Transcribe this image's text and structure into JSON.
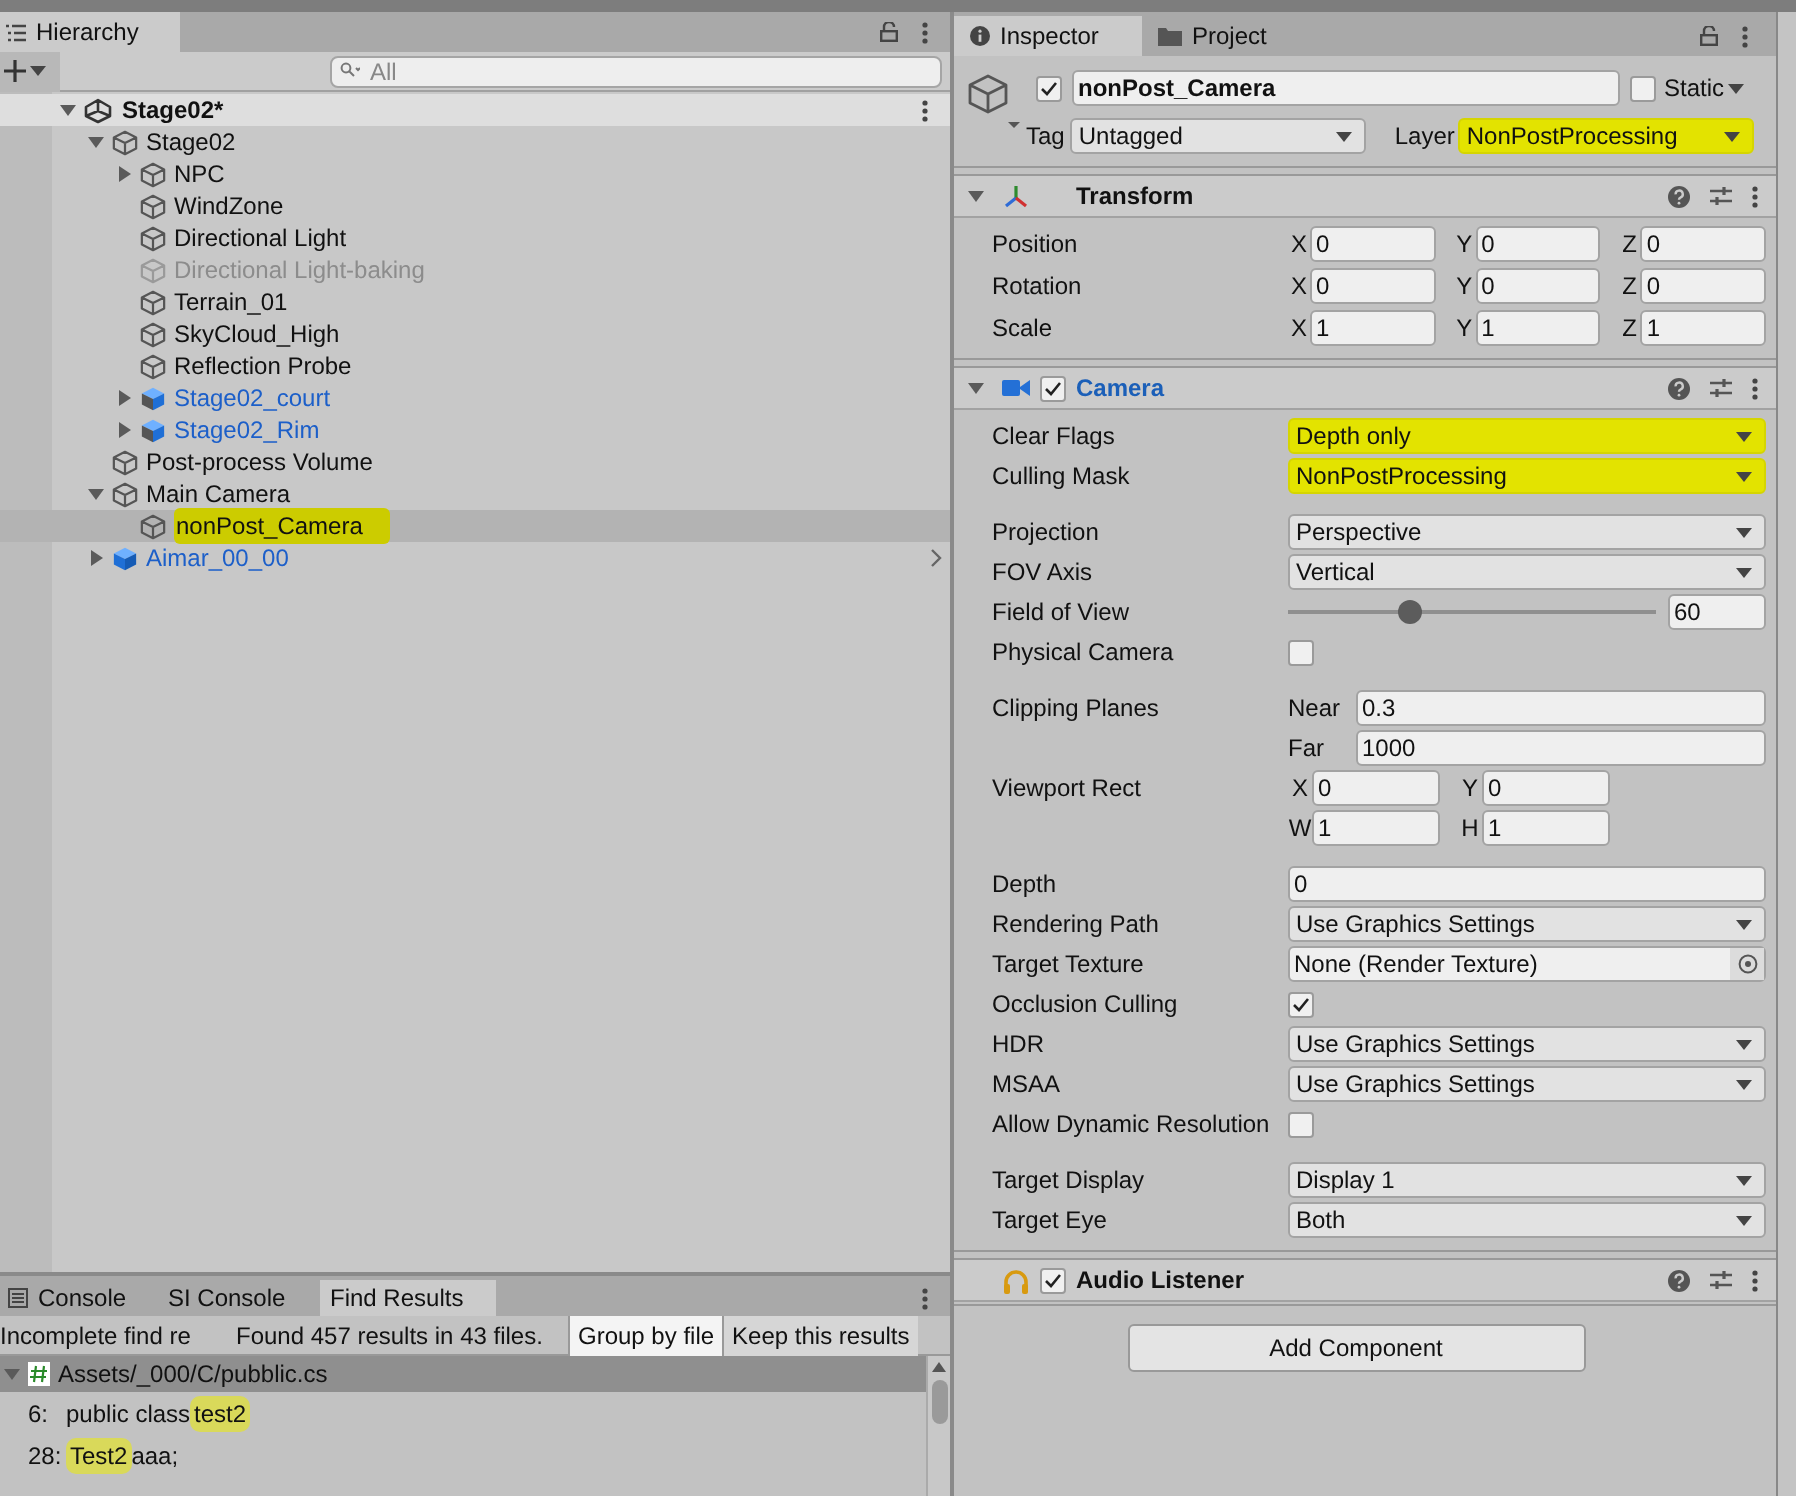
{
  "hierarchy": {
    "title": "Hierarchy",
    "search": {
      "placeholder": "All"
    },
    "scene": {
      "label": "Stage02*",
      "expanded": true,
      "children": [
        {
          "label": "Stage02",
          "kind": "object",
          "expanded": true,
          "disabled": false,
          "selected": false,
          "marked": false,
          "children": [
            {
              "label": "NPC",
              "kind": "object",
              "expanded": false,
              "disabled": false,
              "selected": false,
              "marked": false
            },
            {
              "label": "WindZone",
              "kind": "object",
              "disabled": false,
              "selected": false,
              "marked": false
            },
            {
              "label": "Directional Light",
              "kind": "object",
              "disabled": false,
              "selected": false,
              "marked": false
            },
            {
              "label": "Directional Light-baking",
              "kind": "object",
              "disabled": true,
              "selected": false,
              "marked": false
            },
            {
              "label": "Terrain_01",
              "kind": "object",
              "disabled": false,
              "selected": false,
              "marked": false
            },
            {
              "label": "SkyCloud_High",
              "kind": "object",
              "disabled": false,
              "selected": false,
              "marked": false
            },
            {
              "label": "Reflection Probe",
              "kind": "object",
              "disabled": false,
              "selected": false,
              "marked": false
            },
            {
              "label": "Stage02_court",
              "kind": "model",
              "expanded": false,
              "disabled": false,
              "selected": false,
              "marked": false
            },
            {
              "label": "Stage02_Rim",
              "kind": "model",
              "expanded": false,
              "disabled": false,
              "selected": false,
              "marked": false
            }
          ]
        },
        {
          "label": "Post-process Volume",
          "kind": "object",
          "disabled": false,
          "selected": false,
          "marked": false
        },
        {
          "label": "Main Camera",
          "kind": "object",
          "expanded": true,
          "disabled": false,
          "selected": false,
          "marked": false,
          "children": [
            {
              "label": "nonPost_Camera",
              "kind": "object",
              "disabled": false,
              "selected": true,
              "marked": true
            }
          ]
        },
        {
          "label": "Aimar_00_00",
          "kind": "prefab",
          "expanded": false,
          "disabled": false,
          "selected": false,
          "marked": false
        }
      ]
    }
  },
  "console": {
    "tabs": [
      {
        "label": "Console",
        "selected": false
      },
      {
        "label": "SI Console",
        "selected": false
      },
      {
        "label": "Find Results",
        "selected": true
      }
    ],
    "status": "Incomplete find re",
    "summary": "Found 457 results in 43 files.",
    "buttons": [
      {
        "label": "Group by file",
        "selected": true
      },
      {
        "label": "Keep this results",
        "selected": false
      }
    ],
    "file": {
      "path": "Assets/_000/C/pubblic.cs",
      "expanded": true,
      "selected": true,
      "results": [
        {
          "line": "6:",
          "before": "public class ",
          "match": "test2"
        },
        {
          "line": "28:",
          "match": "Test2",
          "after": " aaa;"
        }
      ]
    }
  },
  "inspector": {
    "tabs": [
      {
        "label": "Inspector",
        "kind": "info",
        "selected": true
      },
      {
        "label": "Project",
        "kind": "folder",
        "selected": false
      }
    ],
    "object": {
      "active": true,
      "name": "nonPost_Camera",
      "static": false,
      "static_label": "Static",
      "tag_label": "Tag",
      "tag": "Untagged",
      "layer_label": "Layer",
      "layer": "NonPostProcessing",
      "layer_marked": true
    },
    "components": [
      {
        "kind": "transform",
        "title": "Transform",
        "expanded": true,
        "modified": false,
        "groups": [
          [
            {
              "kind": "vector3",
              "label": "Position",
              "fields": [
                {
                  "axis": "X",
                  "value": "0"
                },
                {
                  "axis": "Y",
                  "value": "0"
                },
                {
                  "axis": "Z",
                  "value": "0"
                }
              ]
            },
            {
              "kind": "vector3",
              "label": "Rotation",
              "fields": [
                {
                  "axis": "X",
                  "value": "0"
                },
                {
                  "axis": "Y",
                  "value": "0"
                },
                {
                  "axis": "Z",
                  "value": "0"
                }
              ]
            },
            {
              "kind": "vector3",
              "label": "Scale",
              "fields": [
                {
                  "axis": "X",
                  "value": "1"
                },
                {
                  "axis": "Y",
                  "value": "1"
                },
                {
                  "axis": "Z",
                  "value": "1"
                }
              ]
            }
          ]
        ]
      },
      {
        "kind": "camera",
        "title": "Camera",
        "enabled": true,
        "expanded": true,
        "modified": true,
        "groups": [
          [
            {
              "kind": "dropdown",
              "label": "Clear Flags",
              "value": "Depth only",
              "marked": true
            },
            {
              "kind": "dropdown",
              "label": "Culling Mask",
              "value": "NonPostProcessing",
              "marked": true
            }
          ],
          [
            {
              "kind": "dropdown",
              "label": "Projection",
              "value": "Perspective",
              "marked": false
            },
            {
              "kind": "dropdown",
              "label": "FOV Axis",
              "value": "Vertical",
              "marked": false
            },
            {
              "kind": "slider",
              "label": "Field of View",
              "level": 0.33,
              "value": "60"
            },
            {
              "kind": "checkbox",
              "label": "Physical Camera",
              "checked": false
            }
          ],
          [
            {
              "kind": "near_far",
              "label": "Clipping Planes",
              "fields": [
                {
                  "axis": "Near",
                  "value": "0.3"
                },
                {
                  "axis": "Far",
                  "value": "1000"
                }
              ]
            },
            {
              "kind": "rect",
              "label": "Viewport Rect",
              "fields": [
                {
                  "axis": "X",
                  "value": "0"
                },
                {
                  "axis": "Y",
                  "value": "0"
                },
                {
                  "axis": "W",
                  "value": "1"
                },
                {
                  "axis": "H",
                  "value": "1"
                }
              ]
            }
          ],
          [
            {
              "kind": "field",
              "label": "Depth",
              "value": "0"
            },
            {
              "kind": "dropdown",
              "label": "Rendering Path",
              "value": "Use Graphics Settings",
              "marked": false
            },
            {
              "kind": "object",
              "label": "Target Texture",
              "value": "None (Render Texture)"
            },
            {
              "kind": "checkbox",
              "label": "Occlusion Culling",
              "checked": true
            },
            {
              "kind": "dropdown",
              "label": "HDR",
              "value": "Use Graphics Settings",
              "marked": false
            },
            {
              "kind": "dropdown",
              "label": "MSAA",
              "value": "Use Graphics Settings",
              "marked": false
            },
            {
              "kind": "checkbox",
              "label": "Allow Dynamic Resolution",
              "checked": false
            }
          ],
          [
            {
              "kind": "dropdown",
              "label": "Target Display",
              "value": "Display 1",
              "marked": false
            },
            {
              "kind": "dropdown",
              "label": "Target Eye",
              "value": "Both",
              "marked": false
            }
          ]
        ]
      },
      {
        "kind": "audio_listener",
        "title": "Audio Listener",
        "enabled": true,
        "modified": false
      }
    ],
    "add_component": "Add Component"
  }
}
